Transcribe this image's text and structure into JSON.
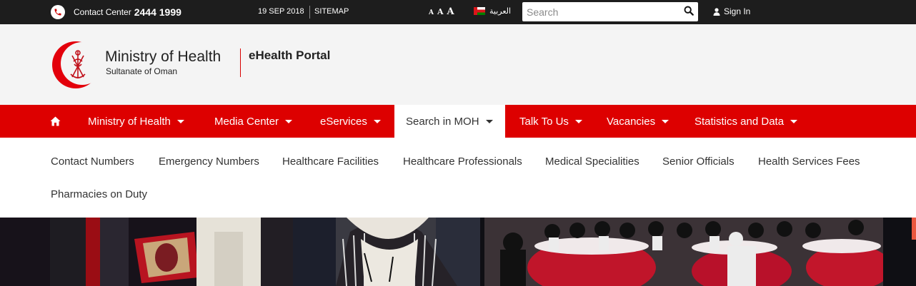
{
  "topbar": {
    "contact_label": "Contact Center",
    "contact_number": "2444 1999",
    "date": "19 SEP 2018",
    "sitemap": "SITEMAP",
    "font_sizes": [
      "A",
      "A",
      "A"
    ],
    "language": "العربية",
    "search_placeholder": "Search",
    "signin": "Sign In"
  },
  "header": {
    "ministry_title": "Ministry of Health",
    "ministry_subtitle": "Sultanate of Oman",
    "portal_title": "eHealth Portal"
  },
  "nav": {
    "items": [
      {
        "label": "Ministry of Health"
      },
      {
        "label": "Media Center"
      },
      {
        "label": "eServices"
      },
      {
        "label": "Search in MOH"
      },
      {
        "label": "Talk To Us"
      },
      {
        "label": "Vacancies"
      },
      {
        "label": "Statistics and Data"
      }
    ]
  },
  "dropdown": {
    "items": [
      {
        "label": "Contact Numbers"
      },
      {
        "label": "Emergency Numbers"
      },
      {
        "label": "Healthcare Facilities"
      },
      {
        "label": "Healthcare Professionals"
      },
      {
        "label": "Medical Specialities"
      },
      {
        "label": "Senior Officials"
      },
      {
        "label": "Health Services Fees"
      },
      {
        "label": "Pharmacies on Duty"
      }
    ]
  },
  "icons": {
    "phone": "phone-icon",
    "search": "search-icon",
    "user": "user-icon",
    "home": "home-icon",
    "caret": "caret-down-icon",
    "flag": "oman-flag-icon"
  },
  "colors": {
    "brand_red": "#dd0000",
    "topbar_bg": "#1d1d1d",
    "header_bg": "#f4f4f4",
    "social_facebook": "#3b5998",
    "social_twitter": "#1da1f2",
    "social_google": "#e9573f"
  }
}
